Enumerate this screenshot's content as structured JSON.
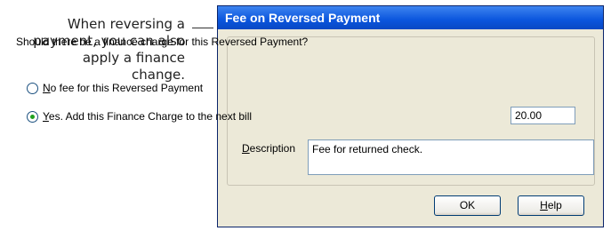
{
  "callout": {
    "line1": "When reversing a",
    "line2": "payment, you can also",
    "line3": "apply a finance",
    "line4": "change."
  },
  "dialog": {
    "title": "Fee on Reversed Payment",
    "question": "Should there be a finance charge for this Reversed Payment?",
    "option_no": {
      "accel": "N",
      "rest": "o fee for this Reversed Payment",
      "selected": false
    },
    "option_yes": {
      "accel": "Y",
      "rest": "es. Add this Finance Charge to the next bill",
      "selected": true
    },
    "amount": "20.00",
    "description_label": {
      "accel": "D",
      "rest": "escription"
    },
    "description_value": "Fee for returned check.",
    "ok_label": "OK",
    "help_label": {
      "accel": "H",
      "rest": "elp"
    }
  }
}
